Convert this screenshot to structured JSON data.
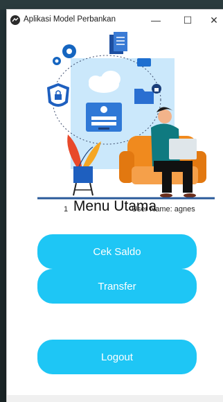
{
  "window": {
    "title": "Aplikasi Model Perbankan",
    "minimize_glyph": "—",
    "maximize_glyph": "☐",
    "close_glyph": "✕"
  },
  "status": {
    "counter": "1",
    "username_label": "User Name: agnes"
  },
  "menu": {
    "title": "Menu Utama",
    "buttons": {
      "cek_saldo": "Cek Saldo",
      "transfer": "Transfer",
      "logout": "Logout"
    }
  },
  "colors": {
    "button": "#1ec6f5",
    "illustration_panel": "#cbe8fb",
    "chair": "#f08a1e",
    "gear": "#1565c0"
  },
  "icons": [
    "app-icon",
    "gear-icon",
    "shield-lock-icon",
    "folder-lock-icon",
    "cloud-icon",
    "login-card-icon",
    "plant-icon",
    "person-laptop-icon"
  ]
}
